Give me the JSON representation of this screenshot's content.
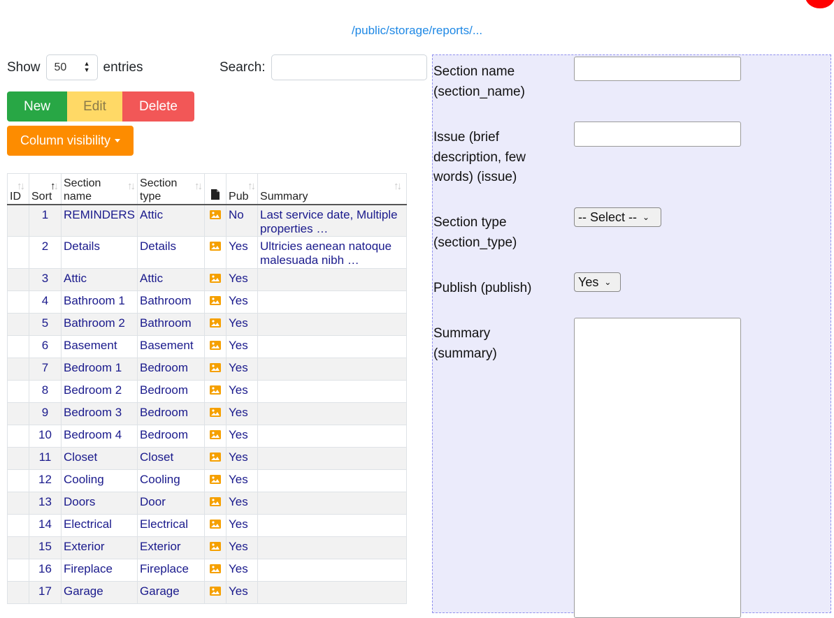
{
  "top": {
    "path_link": "/public/storage/reports/..."
  },
  "controls": {
    "show_label": "Show",
    "entries_value": "50",
    "entries_label": "entries",
    "search_label": "Search:",
    "search_value": ""
  },
  "buttons": {
    "new": "New",
    "edit": "Edit",
    "delete": "Delete",
    "column_visibility": "Column visibility"
  },
  "table": {
    "headers": {
      "id": "ID",
      "sort": "Sort",
      "section_name_1": "Section",
      "section_name_2": "name",
      "section_type_1": "Section",
      "section_type_2": "type",
      "pub": "Pub",
      "summary": "Summary"
    },
    "rows": [
      {
        "sort": "1",
        "name": "REMINDERS",
        "type": "Attic",
        "pub": "No",
        "summary": "Last service date, Multiple properties …"
      },
      {
        "sort": "2",
        "name": "Details",
        "type": "Details",
        "pub": "Yes",
        "summary": "Ultricies aenean natoque malesuada nibh …"
      },
      {
        "sort": "3",
        "name": "Attic",
        "type": "Attic",
        "pub": "Yes",
        "summary": ""
      },
      {
        "sort": "4",
        "name": "Bathroom 1",
        "type": "Bathroom",
        "pub": "Yes",
        "summary": ""
      },
      {
        "sort": "5",
        "name": "Bathroom 2",
        "type": "Bathroom",
        "pub": "Yes",
        "summary": ""
      },
      {
        "sort": "6",
        "name": "Basement",
        "type": "Basement",
        "pub": "Yes",
        "summary": ""
      },
      {
        "sort": "7",
        "name": "Bedroom 1",
        "type": "Bedroom",
        "pub": "Yes",
        "summary": ""
      },
      {
        "sort": "8",
        "name": "Bedroom 2",
        "type": "Bedroom",
        "pub": "Yes",
        "summary": ""
      },
      {
        "sort": "9",
        "name": "Bedroom 3",
        "type": "Bedroom",
        "pub": "Yes",
        "summary": ""
      },
      {
        "sort": "10",
        "name": "Bedroom 4",
        "type": "Bedroom",
        "pub": "Yes",
        "summary": ""
      },
      {
        "sort": "11",
        "name": "Closet",
        "type": "Closet",
        "pub": "Yes",
        "summary": ""
      },
      {
        "sort": "12",
        "name": "Cooling",
        "type": "Cooling",
        "pub": "Yes",
        "summary": ""
      },
      {
        "sort": "13",
        "name": "Doors",
        "type": "Door",
        "pub": "Yes",
        "summary": ""
      },
      {
        "sort": "14",
        "name": "Electrical",
        "type": "Electrical",
        "pub": "Yes",
        "summary": ""
      },
      {
        "sort": "15",
        "name": "Exterior",
        "type": "Exterior",
        "pub": "Yes",
        "summary": ""
      },
      {
        "sort": "16",
        "name": "Fireplace",
        "type": "Fireplace",
        "pub": "Yes",
        "summary": ""
      },
      {
        "sort": "17",
        "name": "Garage",
        "type": "Garage",
        "pub": "Yes",
        "summary": ""
      }
    ]
  },
  "form": {
    "section_name_label": "Section name (section_name)",
    "section_name_value": "",
    "issue_label": "Issue (brief description, few words) (issue)",
    "issue_value": "",
    "section_type_label": "Section type (section_type)",
    "section_type_value": "-- Select --",
    "publish_label": "Publish (publish)",
    "publish_value": "Yes",
    "summary_label": "Summary (summary)",
    "summary_value": ""
  },
  "colors": {
    "new_button": "#28a745",
    "edit_button": "#ffd966",
    "delete_button": "#f25757",
    "column_visibility_button": "#fd8c00",
    "form_background": "#ebebfb",
    "row_text": "#1a1a8c",
    "path_link": "#1e88e5",
    "image_icon": "#f5a000"
  }
}
